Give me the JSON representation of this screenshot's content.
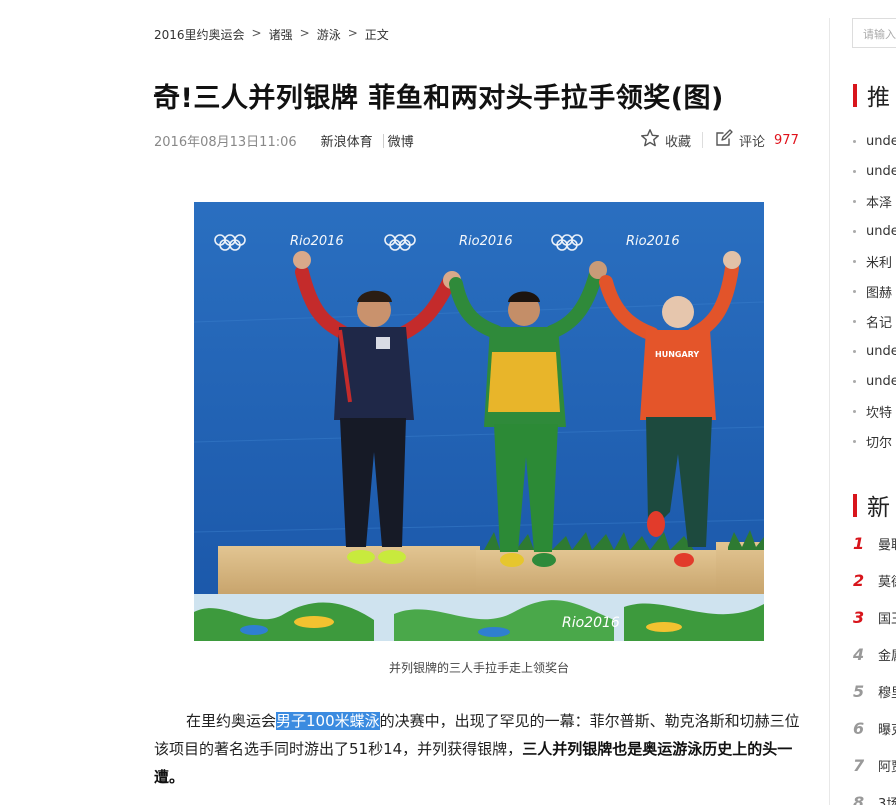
{
  "breadcrumb": [
    "2016里约奥运会",
    "诸强",
    "游泳",
    "正文"
  ],
  "breadcrumb_sep": ">",
  "article": {
    "title": "奇!三人并列银牌 菲鱼和两对头手拉手领奖(图)",
    "date": "2016年08月13日11:06",
    "source": "新浪体育",
    "weibo": "微博",
    "favorite_label": "收藏",
    "comment_label": "评论",
    "comment_count": "977",
    "photo_caption": "并列银牌的三人手拉手走上领奖台",
    "photo_banner_text": [
      "Rio2016",
      "Rio2016",
      "Rio2016"
    ],
    "photo_podium_text": "Rio2016",
    "photo_shirt_text": "HUNGARY",
    "para_before": "在里约奥运会",
    "para_highlight": "男子100米蝶泳",
    "para_middle": "的决赛中，出现了罕见的一幕：菲尔普斯、勒克洛斯和切赫三位该项目的著名选手同时游出了51秒14，并列获得银牌，",
    "para_bold": "三人并列银牌也是奥运游泳历史上的头一遭。"
  },
  "sidebar": {
    "search_placeholder": "请输入",
    "recommend_title": "推",
    "recommend_items": [
      "unde",
      "unde",
      "本泽",
      "unde",
      "米利",
      "图赫",
      "名记",
      "unde",
      "unde",
      "坎特",
      "切尔"
    ],
    "news_title": "新",
    "news_items": [
      {
        "rank": "1",
        "text": "曼联"
      },
      {
        "rank": "2",
        "text": "莫德"
      },
      {
        "rank": "3",
        "text": "国王"
      },
      {
        "rank": "4",
        "text": "金属"
      },
      {
        "rank": "5",
        "text": "穆里"
      },
      {
        "rank": "6",
        "text": "曝克"
      },
      {
        "rank": "7",
        "text": "阿贾"
      },
      {
        "rank": "8",
        "text": "3场"
      }
    ]
  },
  "colors": {
    "accent_red": "#d8151c",
    "highlight_blue": "#3b8be0"
  }
}
